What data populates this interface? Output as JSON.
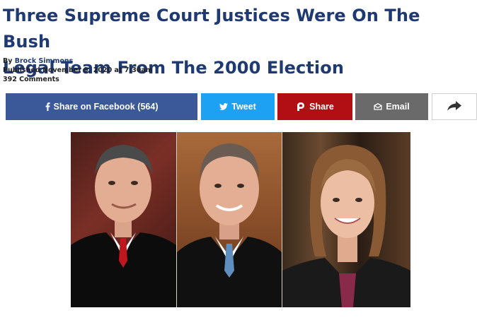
{
  "article": {
    "headline_line1": "Three Supreme Court Justices Were On The Bush",
    "headline_line2": "Legal Team From The 2000 Election",
    "by_prefix": "By",
    "author": "Brock Simmons",
    "published": "Published November 9, 2020 at 7:30am",
    "comments": "392 Comments"
  },
  "share": {
    "facebook_label": "Share on Facebook (564)",
    "twitter_label": "Tweet",
    "parler_label": "Share",
    "email_label": "Email"
  },
  "icons": {
    "facebook": "facebook-f-icon",
    "twitter": "twitter-bird-icon",
    "parler": "parler-p-icon",
    "email": "envelope-icon",
    "more": "share-arrow-icon"
  },
  "colors": {
    "headline": "#1f3a72",
    "facebook": "#3b5998",
    "twitter": "#1da1f2",
    "parler": "#b20f14",
    "email": "#6a6a6a"
  }
}
